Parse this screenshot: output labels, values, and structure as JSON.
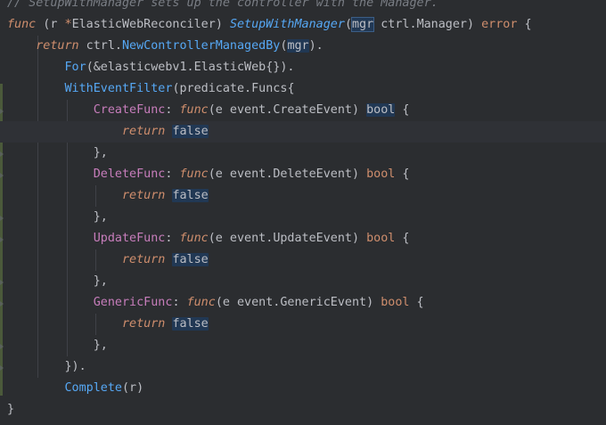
{
  "editor": {
    "lines": [
      {
        "tokens": [
          {
            "c": "cm",
            "t": "// "
          },
          {
            "c": "cm",
            "t": "SetupWithManager"
          },
          {
            "c": "cm",
            "t": " sets up the controller with the Manager."
          }
        ]
      },
      {
        "tokens": [
          {
            "c": "kwi",
            "t": "func"
          },
          {
            "c": "",
            "t": " (r "
          },
          {
            "c": "kw",
            "t": "*"
          },
          {
            "c": "ty",
            "t": "ElasticWebReconciler"
          },
          {
            "c": "",
            "t": ") "
          },
          {
            "c": "fni",
            "t": "SetupWithManager"
          },
          {
            "c": "",
            "t": "("
          },
          {
            "c": "hl2",
            "t": "mgr"
          },
          {
            "c": "",
            "t": " ctrl."
          },
          {
            "c": "ty",
            "t": "Manager"
          },
          {
            "c": "",
            "t": ") "
          },
          {
            "c": "kw",
            "t": "error"
          },
          {
            "c": "",
            "t": " {"
          }
        ]
      },
      {
        "tokens": [
          {
            "c": "",
            "t": "    "
          },
          {
            "c": "kwi",
            "t": "return"
          },
          {
            "c": "",
            "t": " ctrl."
          },
          {
            "c": "fn",
            "t": "NewControllerManagedBy"
          },
          {
            "c": "",
            "t": "("
          },
          {
            "c": "hl",
            "t": "mgr"
          },
          {
            "c": "",
            "t": ")."
          }
        ]
      },
      {
        "tokens": [
          {
            "c": "",
            "t": "        "
          },
          {
            "c": "fn",
            "t": "For"
          },
          {
            "c": "",
            "t": "(&elasticwebv1."
          },
          {
            "c": "ty",
            "t": "ElasticWeb"
          },
          {
            "c": "",
            "t": "{})."
          }
        ]
      },
      {
        "tokens": [
          {
            "c": "",
            "t": "        "
          },
          {
            "c": "fn",
            "t": "WithEventFilter"
          },
          {
            "c": "",
            "t": "(predicate."
          },
          {
            "c": "ty",
            "t": "Funcs"
          },
          {
            "c": "",
            "t": "{"
          }
        ]
      },
      {
        "tokens": [
          {
            "c": "",
            "t": "            "
          },
          {
            "c": "fld",
            "t": "CreateFunc"
          },
          {
            "c": "",
            "t": ": "
          },
          {
            "c": "kwi",
            "t": "func"
          },
          {
            "c": "",
            "t": "(e event."
          },
          {
            "c": "ty",
            "t": "CreateEvent"
          },
          {
            "c": "",
            "t": ") "
          },
          {
            "c": "hl",
            "t": "bool"
          },
          {
            "c": "",
            "t": " {"
          }
        ]
      },
      {
        "tokens": [
          {
            "c": "",
            "t": "                "
          },
          {
            "c": "kwi",
            "t": "return"
          },
          {
            "c": "",
            "t": " "
          },
          {
            "c": "hl",
            "t": "false"
          }
        ],
        "current": true
      },
      {
        "tokens": [
          {
            "c": "",
            "t": "            },"
          }
        ]
      },
      {
        "tokens": [
          {
            "c": "",
            "t": "            "
          },
          {
            "c": "fld",
            "t": "DeleteFunc"
          },
          {
            "c": "",
            "t": ": "
          },
          {
            "c": "kwi",
            "t": "func"
          },
          {
            "c": "",
            "t": "(e event."
          },
          {
            "c": "ty",
            "t": "DeleteEvent"
          },
          {
            "c": "",
            "t": ") "
          },
          {
            "c": "kw",
            "t": "bool"
          },
          {
            "c": "",
            "t": " {"
          }
        ]
      },
      {
        "tokens": [
          {
            "c": "",
            "t": "                "
          },
          {
            "c": "kwi",
            "t": "return"
          },
          {
            "c": "",
            "t": " "
          },
          {
            "c": "hl",
            "t": "false"
          }
        ]
      },
      {
        "tokens": [
          {
            "c": "",
            "t": "            },"
          }
        ]
      },
      {
        "tokens": [
          {
            "c": "",
            "t": "            "
          },
          {
            "c": "fld",
            "t": "UpdateFunc"
          },
          {
            "c": "",
            "t": ": "
          },
          {
            "c": "kwi",
            "t": "func"
          },
          {
            "c": "",
            "t": "(e event."
          },
          {
            "c": "ty",
            "t": "UpdateEvent"
          },
          {
            "c": "",
            "t": ") "
          },
          {
            "c": "kw",
            "t": "bool"
          },
          {
            "c": "",
            "t": " {"
          }
        ]
      },
      {
        "tokens": [
          {
            "c": "",
            "t": "                "
          },
          {
            "c": "kwi",
            "t": "return"
          },
          {
            "c": "",
            "t": " "
          },
          {
            "c": "hl",
            "t": "false"
          }
        ]
      },
      {
        "tokens": [
          {
            "c": "",
            "t": "            },"
          }
        ]
      },
      {
        "tokens": [
          {
            "c": "",
            "t": "            "
          },
          {
            "c": "fld",
            "t": "GenericFunc"
          },
          {
            "c": "",
            "t": ": "
          },
          {
            "c": "kwi",
            "t": "func"
          },
          {
            "c": "",
            "t": "(e event."
          },
          {
            "c": "ty",
            "t": "GenericEvent"
          },
          {
            "c": "",
            "t": ") "
          },
          {
            "c": "kw",
            "t": "bool"
          },
          {
            "c": "",
            "t": " {"
          }
        ]
      },
      {
        "tokens": [
          {
            "c": "",
            "t": "                "
          },
          {
            "c": "kwi",
            "t": "return"
          },
          {
            "c": "",
            "t": " "
          },
          {
            "c": "hl",
            "t": "false"
          }
        ]
      },
      {
        "tokens": [
          {
            "c": "",
            "t": "            },"
          }
        ]
      },
      {
        "tokens": [
          {
            "c": "",
            "t": "        })."
          }
        ]
      },
      {
        "tokens": [
          {
            "c": "",
            "t": "        "
          },
          {
            "c": "fn",
            "t": "Complete"
          },
          {
            "c": "",
            "t": "(r)"
          }
        ]
      },
      {
        "tokens": [
          {
            "c": "",
            "t": "}"
          }
        ]
      }
    ]
  }
}
